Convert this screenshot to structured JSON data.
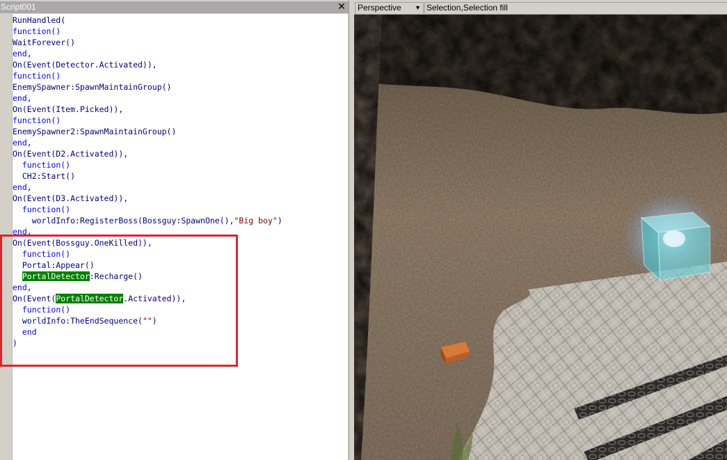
{
  "script_window": {
    "title": "Script001",
    "close_icon": "close-icon",
    "code_lines": [
      [
        {
          "t": "RunHandled("
        }
      ],
      [
        {
          "t": "function()",
          "c": "kw"
        }
      ],
      [
        {
          "t": "WaitForever()"
        }
      ],
      [
        {
          "t": "end",
          "c": "kw"
        },
        {
          "t": ","
        }
      ],
      [
        {
          "t": "On(Event(Detector.Activated)),"
        }
      ],
      [
        {
          "t": "function()",
          "c": "kw"
        }
      ],
      [
        {
          "t": "EnemySpawner:SpawnMaintainGroup()"
        }
      ],
      [
        {
          "t": "end",
          "c": "kw"
        },
        {
          "t": ","
        }
      ],
      [
        {
          "t": "On(Event(Item.Picked)),"
        }
      ],
      [
        {
          "t": "function()",
          "c": "kw"
        }
      ],
      [
        {
          "t": "EnemySpawner2:SpawnMaintainGroup()"
        }
      ],
      [
        {
          "t": "end",
          "c": "kw"
        },
        {
          "t": ","
        }
      ],
      [
        {
          "t": "On(Event(D2.Activated)),"
        }
      ],
      [
        {
          "t": "  "
        },
        {
          "t": "function()",
          "c": "kw"
        }
      ],
      [
        {
          "t": "  CH2:Start()"
        }
      ],
      [
        {
          "t": "end",
          "c": "kw"
        },
        {
          "t": ","
        }
      ],
      [
        {
          "t": "On(Event(D3.Activated)),"
        }
      ],
      [
        {
          "t": "  "
        },
        {
          "t": "function()",
          "c": "kw"
        }
      ],
      [
        {
          "t": "    worldInfo:RegisterBoss(Bossguy:SpawnOne(),"
        },
        {
          "t": "\"Big boy\"",
          "c": "str"
        },
        {
          "t": ")"
        }
      ],
      [
        {
          "t": "end",
          "c": "kw"
        },
        {
          "t": ","
        }
      ],
      [
        {
          "t": "On(Event(Bossguy.OneKilled)),"
        }
      ],
      [
        {
          "t": "  "
        },
        {
          "t": "function()",
          "c": "kw"
        }
      ],
      [
        {
          "t": "  Portal:Appear()"
        }
      ],
      [
        {
          "t": "  "
        },
        {
          "t": "PortalDetector",
          "c": "hl"
        },
        {
          "t": ":Recharge()"
        }
      ],
      [
        {
          "t": "end",
          "c": "kw"
        },
        {
          "t": ","
        }
      ],
      [
        {
          "t": "On(Event("
        },
        {
          "t": "PortalDetector",
          "c": "hl"
        },
        {
          "t": ".Activated)),"
        }
      ],
      [
        {
          "t": "  "
        },
        {
          "t": "function()",
          "c": "kw"
        }
      ],
      [
        {
          "t": "  worldInfo:TheEndSequence("
        },
        {
          "t": "\"\"",
          "c": "str"
        },
        {
          "t": ")"
        }
      ],
      [
        {
          "t": "  "
        },
        {
          "t": "end",
          "c": "kw"
        }
      ],
      [
        {
          "t": ")"
        }
      ]
    ]
  },
  "viewport": {
    "view_mode": "Perspective",
    "render_mode": "Selection,Selection fill",
    "dropdown_icon": "chevron-down-icon"
  },
  "colors": {
    "highlight_box": "#e0232b",
    "keyword": "#0000ff",
    "identifier": "#000080",
    "string": "#800000",
    "selection_highlight": "#008000"
  }
}
